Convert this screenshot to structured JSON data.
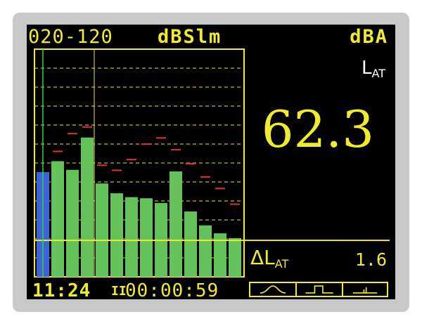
{
  "header": {
    "range": "020-120",
    "mode": "dBSlm",
    "weighting": "dBA"
  },
  "readout": {
    "parameter": "L",
    "parameter_sub": "AT",
    "value": "62.3",
    "delta_parameter": "ΔL",
    "delta_sub": "AT",
    "delta_value": "1.6"
  },
  "footer": {
    "clock": "11:24",
    "run_state": "II",
    "elapsed": "00:00:59",
    "view_buttons": [
      "curve-view-icon",
      "spectrum-view-icon",
      "bargraph-view-icon"
    ]
  },
  "colors": {
    "text": "#f2ea2c",
    "frame": "#f2ea2c",
    "bar_total": "#3a64d8",
    "bar_band": "#63c35a",
    "max_marker": "#e0352b",
    "cursor": "#37d137"
  },
  "chart_data": {
    "type": "bar",
    "levels_relative": [
      0.46,
      0.508,
      0.47,
      0.612,
      0.41,
      0.367,
      0.35,
      0.345,
      0.324,
      0.463,
      0.287,
      0.226,
      0.191,
      0.17
    ],
    "max_markers_relative": [
      null,
      0.551,
      0.629,
      0.658,
      0.49,
      0.468,
      0.515,
      0.583,
      0.61,
      0.558,
      0.497,
      0.439,
      0.388,
      0.319
    ],
    "bar_kinds": [
      "total",
      "band",
      "band",
      "band",
      "band",
      "band",
      "band",
      "band",
      "band",
      "band",
      "band",
      "band",
      "band",
      "band"
    ],
    "grid": true,
    "grid_lines": 12,
    "threshold_relative": 0.16,
    "cursor_index": 0
  }
}
